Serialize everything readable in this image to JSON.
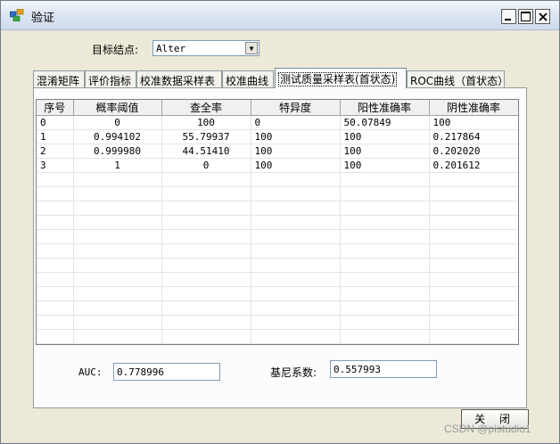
{
  "window": {
    "title": "验证"
  },
  "target": {
    "label": "目标结点:",
    "value": "Alter"
  },
  "tabs": [
    "混淆矩阵",
    "评价指标",
    "校准数据采样表",
    "校准曲线",
    "测试质量采样表(首状态)",
    "ROC曲线（首状态）"
  ],
  "active_tab_index": 4,
  "table": {
    "headers": [
      "序号",
      "概率阈值",
      "查全率",
      "特异度",
      "阳性准确率",
      "阴性准确率"
    ],
    "rows": [
      [
        "0",
        "0",
        "100",
        "0",
        "50.07849",
        "100"
      ],
      [
        "1",
        "0.994102",
        "55.79937",
        "100",
        "100",
        "0.217864"
      ],
      [
        "2",
        "0.999980",
        "44.51410",
        "100",
        "100",
        "0.202020"
      ],
      [
        "3",
        "1",
        "0",
        "100",
        "100",
        "0.201612"
      ]
    ]
  },
  "auc": {
    "label": "AUC:",
    "value": "0.778996"
  },
  "gini": {
    "label": "基尼系数:",
    "value": "0.557993"
  },
  "close_label": "关 闭",
  "watermark": "CSDN @pistudio1"
}
